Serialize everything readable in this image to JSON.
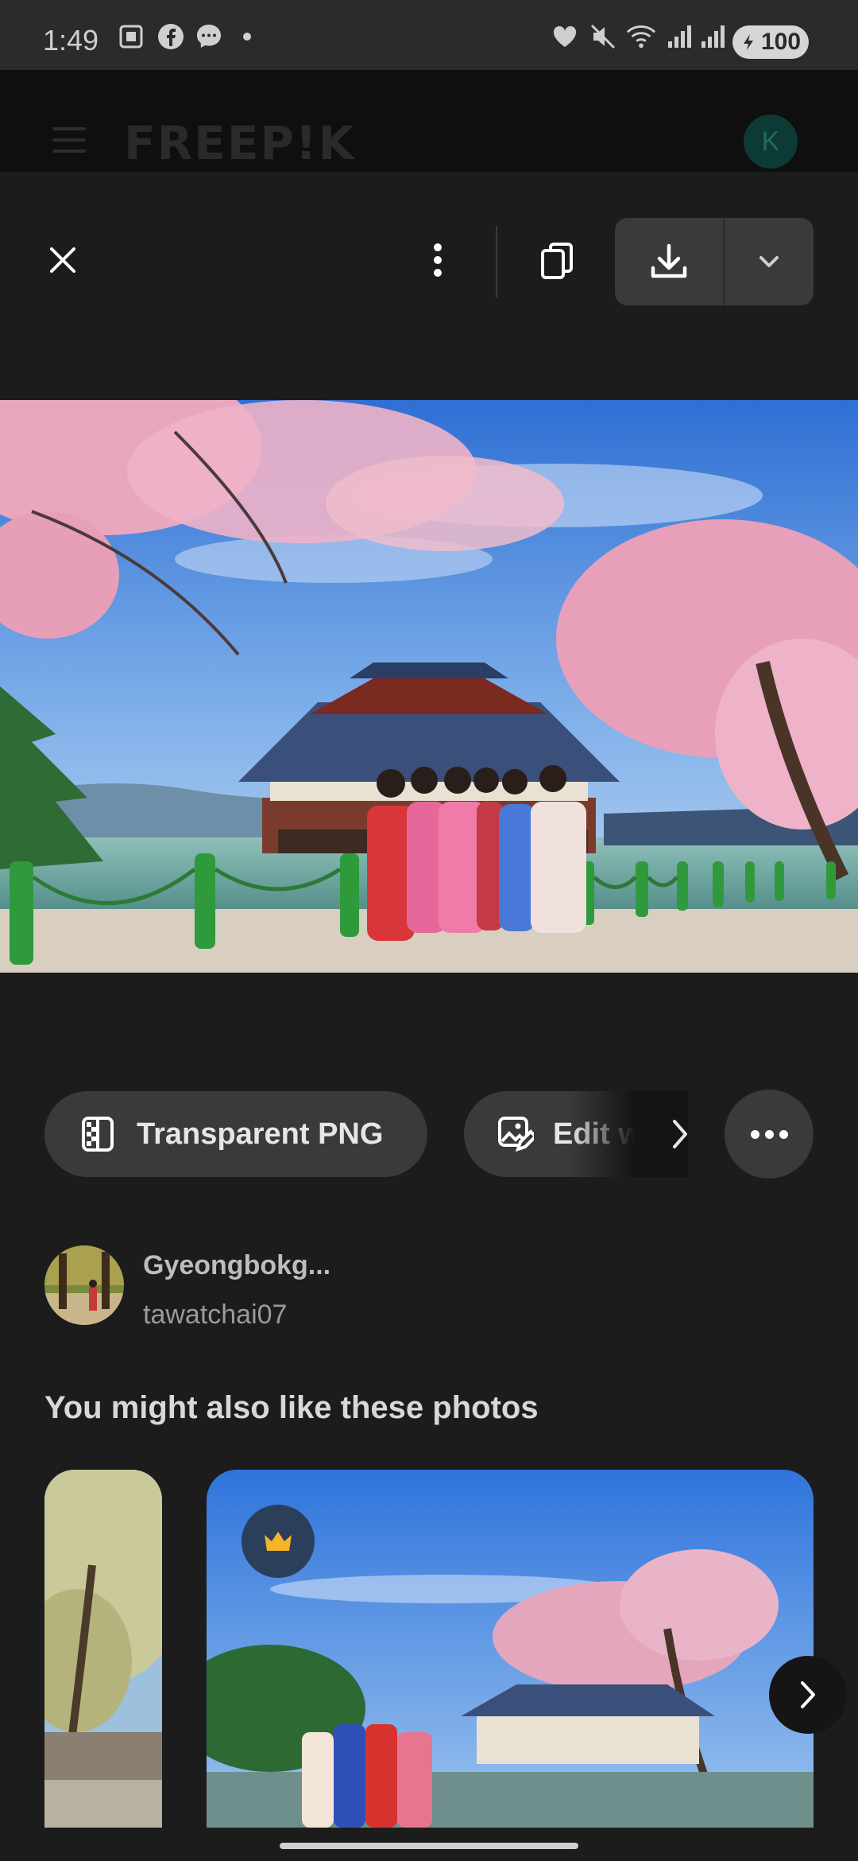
{
  "status_bar": {
    "time": "1:49",
    "battery": "100",
    "icons": [
      "screenshot-icon",
      "facebook-icon",
      "messenger-icon",
      "dot-icon",
      "heart-icon",
      "mute-icon",
      "wifi-icon",
      "signal-icon",
      "signal-icon",
      "battery-icon"
    ]
  },
  "app_header": {
    "logo": "FREEP!K",
    "avatar_initial": "K"
  },
  "toolbar": {
    "icons": [
      "close-icon",
      "more-vertical-icon",
      "copy-icon",
      "download-icon",
      "chevron-down-icon"
    ]
  },
  "actions": {
    "transparent_png": "Transparent PNG",
    "edit": "Edit w"
  },
  "author": {
    "photo_title": "Gyeongbokg...",
    "username": "tawatchai07"
  },
  "related": {
    "title": "You might also like these photos"
  },
  "colors": {
    "background": "#1c1c1c",
    "chip": "#3a3a3a",
    "premium_crown": "#f5b52a"
  }
}
